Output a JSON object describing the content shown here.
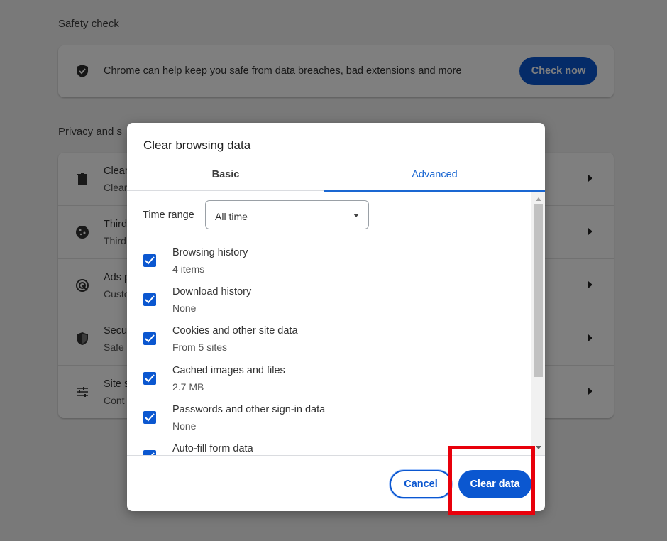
{
  "background": {
    "safety_check": {
      "title": "Safety check",
      "description": "Chrome can help keep you safe from data breaches, bad extensions and more",
      "button_label": "Check now",
      "icon": "shield-check-icon"
    },
    "privacy": {
      "title": "Privacy and s",
      "rows": [
        {
          "icon": "trash-icon",
          "line1": "Clear",
          "line2": "Clear"
        },
        {
          "icon": "cookie-icon",
          "line1": "Third",
          "line2": "Third"
        },
        {
          "icon": "ads-icon",
          "line1": "Ads p",
          "line2": "Custo"
        },
        {
          "icon": "security-icon",
          "line1": "Secu",
          "line2": "Safe"
        },
        {
          "icon": "tune-icon",
          "line1": "Site s",
          "line2": "Cont"
        }
      ]
    }
  },
  "dialog": {
    "title": "Clear browsing data",
    "tabs": [
      {
        "label": "Basic",
        "active": false
      },
      {
        "label": "Advanced",
        "active": true
      }
    ],
    "time_range": {
      "label": "Time range",
      "value": "All time"
    },
    "options": [
      {
        "name": "Browsing history",
        "detail": "4 items",
        "checked": true
      },
      {
        "name": "Download history",
        "detail": "None",
        "checked": true
      },
      {
        "name": "Cookies and other site data",
        "detail": "From 5 sites",
        "checked": true
      },
      {
        "name": "Cached images and files",
        "detail": "2.7 MB",
        "checked": true
      },
      {
        "name": "Passwords and other sign-in data",
        "detail": "None",
        "checked": true
      },
      {
        "name": "Auto-fill form data",
        "detail": "",
        "checked": true
      }
    ],
    "cancel_label": "Cancel",
    "clear_label": "Clear data"
  },
  "colors": {
    "accent": "#0b57d0",
    "tab_active": "#1a67d2",
    "highlight": "#e8000b"
  }
}
